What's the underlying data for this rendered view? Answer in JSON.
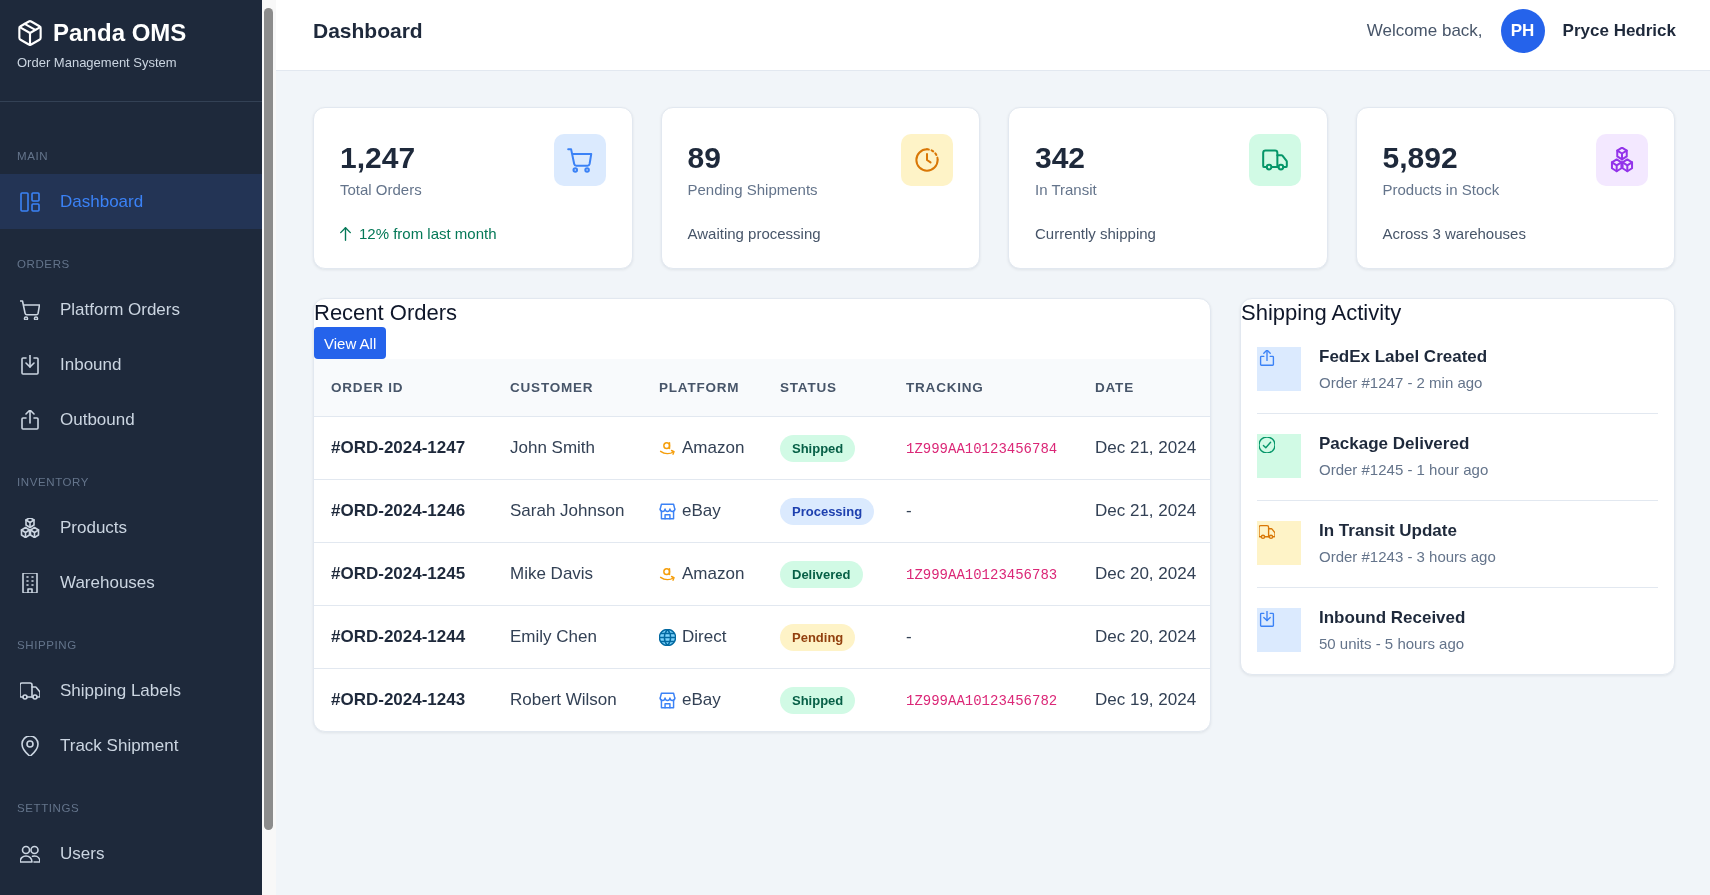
{
  "sidebar": {
    "brand": {
      "name": "Panda OMS",
      "tagline": "Order Management System"
    },
    "sections": [
      {
        "heading": "MAIN",
        "items": [
          {
            "label": "Dashboard",
            "selected": true
          }
        ]
      },
      {
        "heading": "ORDERS",
        "items": [
          {
            "label": "Platform Orders",
            "selected": false
          },
          {
            "label": "Inbound",
            "selected": false
          },
          {
            "label": "Outbound",
            "selected": false
          }
        ]
      },
      {
        "heading": "INVENTORY",
        "items": [
          {
            "label": "Products",
            "selected": false
          },
          {
            "label": "Warehouses",
            "selected": false
          }
        ]
      },
      {
        "heading": "SHIPPING",
        "items": [
          {
            "label": "Shipping Labels",
            "selected": false
          },
          {
            "label": "Track Shipment",
            "selected": false
          }
        ]
      },
      {
        "heading": "SETTINGS",
        "items": [
          {
            "label": "Users",
            "selected": false
          }
        ]
      }
    ]
  },
  "header": {
    "title": "Dashboard",
    "greeting": "Welcome back,",
    "user": {
      "initials": "PH",
      "name": "Pryce Hedrick"
    }
  },
  "stats": [
    {
      "value": "1,247",
      "label": "Total Orders",
      "note": "12% from last month",
      "trending_up": true,
      "color": "#dbeafe"
    },
    {
      "value": "89",
      "label": "Pending Shipments",
      "note": "Awaiting processing",
      "trending_up": false,
      "color": "#fef3c7"
    },
    {
      "value": "342",
      "label": "In Transit",
      "note": "Currently shipping",
      "trending_up": false,
      "color": "#d1fae5"
    },
    {
      "value": "5,892",
      "label": "Products in Stock",
      "note": "Across 3 warehouses",
      "trending_up": false,
      "color": "#f3e8ff"
    }
  ],
  "recent_orders": {
    "title": "Recent Orders",
    "button": "View All",
    "columns": [
      "ORDER ID",
      "CUSTOMER",
      "PLATFORM",
      "STATUS",
      "TRACKING",
      "DATE"
    ],
    "rows": [
      {
        "order_id": "#ORD-2024-1247",
        "customer": "John Smith",
        "platform": "Amazon",
        "status": {
          "label": "Shipped",
          "color": "#d1fae5"
        },
        "tracking": {
          "kind": "code",
          "text": "1Z999AA10123456784"
        },
        "date": "Dec 21, 2024"
      },
      {
        "order_id": "#ORD-2024-1246",
        "customer": "Sarah Johnson",
        "platform": "eBay",
        "status": {
          "label": "Processing",
          "color": "#dbeafe"
        },
        "tracking": {
          "kind": "none",
          "text": "-"
        },
        "date": "Dec 21, 2024"
      },
      {
        "order_id": "#ORD-2024-1245",
        "customer": "Mike Davis",
        "platform": "Amazon",
        "status": {
          "label": "Delivered",
          "color": "#d1fae5"
        },
        "tracking": {
          "kind": "code",
          "text": "1Z999AA10123456783"
        },
        "date": "Dec 20, 2024"
      },
      {
        "order_id": "#ORD-2024-1244",
        "customer": "Emily Chen",
        "platform": "Direct",
        "status": {
          "label": "Pending",
          "color": "#fef3c7"
        },
        "tracking": {
          "kind": "none",
          "text": "-"
        },
        "date": "Dec 20, 2024"
      },
      {
        "order_id": "#ORD-2024-1243",
        "customer": "Robert Wilson",
        "platform": "eBay",
        "status": {
          "label": "Shipped",
          "color": "#d1fae5"
        },
        "tracking": {
          "kind": "code",
          "text": "1Z999AA10123456782"
        },
        "date": "Dec 19, 2024"
      }
    ]
  },
  "shipping_activity": {
    "title": "Shipping Activity",
    "items": [
      {
        "title": "FedEx Label Created",
        "detail": "Order #1247 - 2 min ago",
        "color": "#dbeafe"
      },
      {
        "title": "Package Delivered",
        "detail": "Order #1245 - 1 hour ago",
        "color": "#d1fae5"
      },
      {
        "title": "In Transit Update",
        "detail": "Order #1243 - 3 hours ago",
        "color": "#fef3c7"
      },
      {
        "title": "Inbound Received",
        "detail": "50 units - 5 hours ago",
        "color": "#dbeafe"
      }
    ]
  }
}
